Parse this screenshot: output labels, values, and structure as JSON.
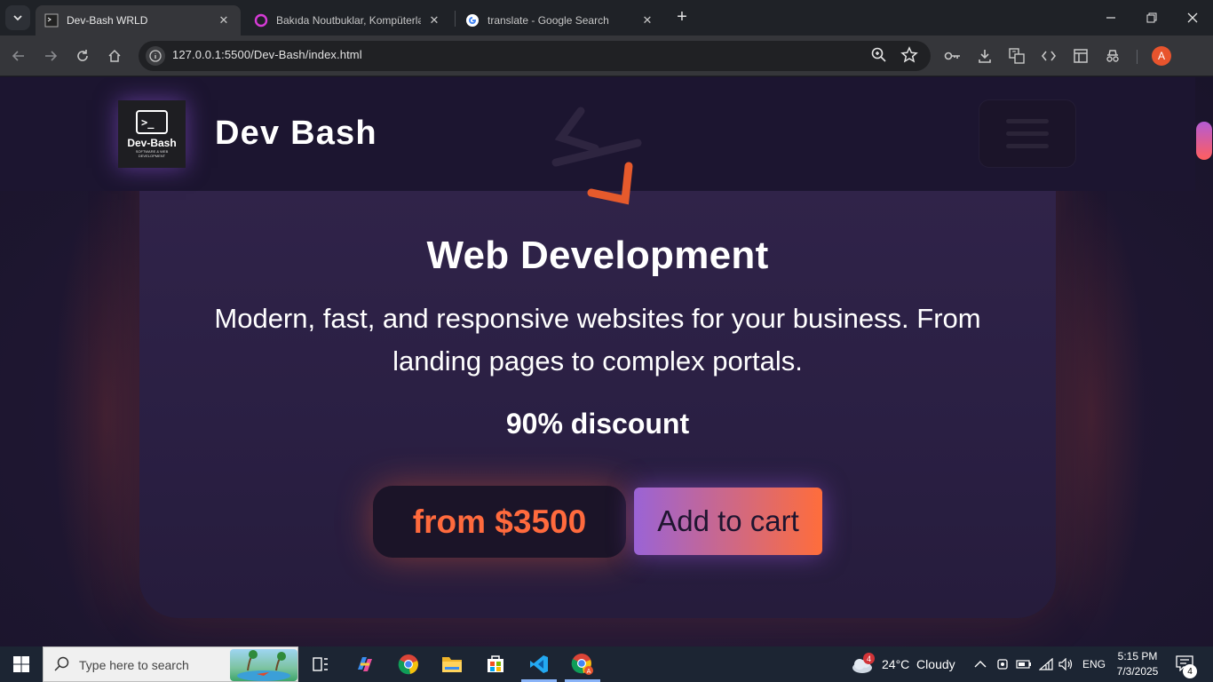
{
  "browser": {
    "tabs": [
      {
        "title": "Dev-Bash WRLD"
      },
      {
        "title": "Bakıda Noutbuklar, Kompüterlər"
      },
      {
        "title": "translate - Google Search"
      }
    ],
    "url": "127.0.0.1:5500/Dev-Bash/index.html",
    "profile_initial": "A"
  },
  "site": {
    "logo_text": "Dev-Bash",
    "logo_subtext": "SOFTWARE & WEB DEVELOPMENT",
    "brand": "Dev Bash"
  },
  "card": {
    "title": "Web Development",
    "description": "Modern, fast, and responsive websites for your business. From landing pages to complex portals.",
    "discount": "90% discount",
    "price": "from $3500",
    "cart_label": "Add to cart"
  },
  "taskbar": {
    "search_placeholder": "Type here to search",
    "weather": "24°C  Cloudy",
    "weather_badge": "4",
    "language": "ENG",
    "time": "5:15 PM",
    "date": "7/3/2025",
    "notifications": "4"
  },
  "colors": {
    "accent_orange": "#ff6a3d",
    "accent_purple": "#9a63d6",
    "page_bg": "#201733"
  }
}
